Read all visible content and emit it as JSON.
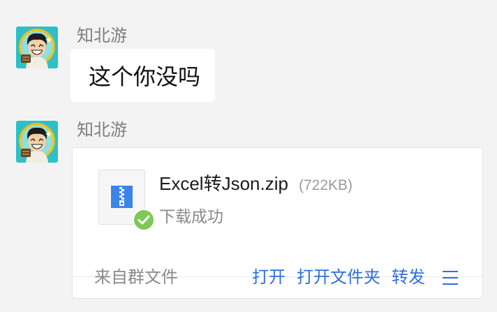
{
  "messages": [
    {
      "sender": "知北游",
      "avatar_icon": "avatar-icon",
      "text": "这个你没吗"
    },
    {
      "sender": "知北游",
      "avatar_icon": "avatar-icon",
      "file": {
        "name": "Excel转Json.zip",
        "size": "(722KB)",
        "status": "下载成功",
        "source": "来自群文件",
        "file_type_icon": "zip-file-icon",
        "status_icon": "check-circle-icon",
        "actions": [
          {
            "label": "打开"
          },
          {
            "label": "打开文件夹"
          },
          {
            "label": "转发"
          }
        ],
        "more_icon": "menu-icon"
      }
    }
  ],
  "colors": {
    "background": "#f3f3f4",
    "link": "#2e6fe0",
    "success": "#7cc956",
    "zip": "#3b84ea"
  }
}
